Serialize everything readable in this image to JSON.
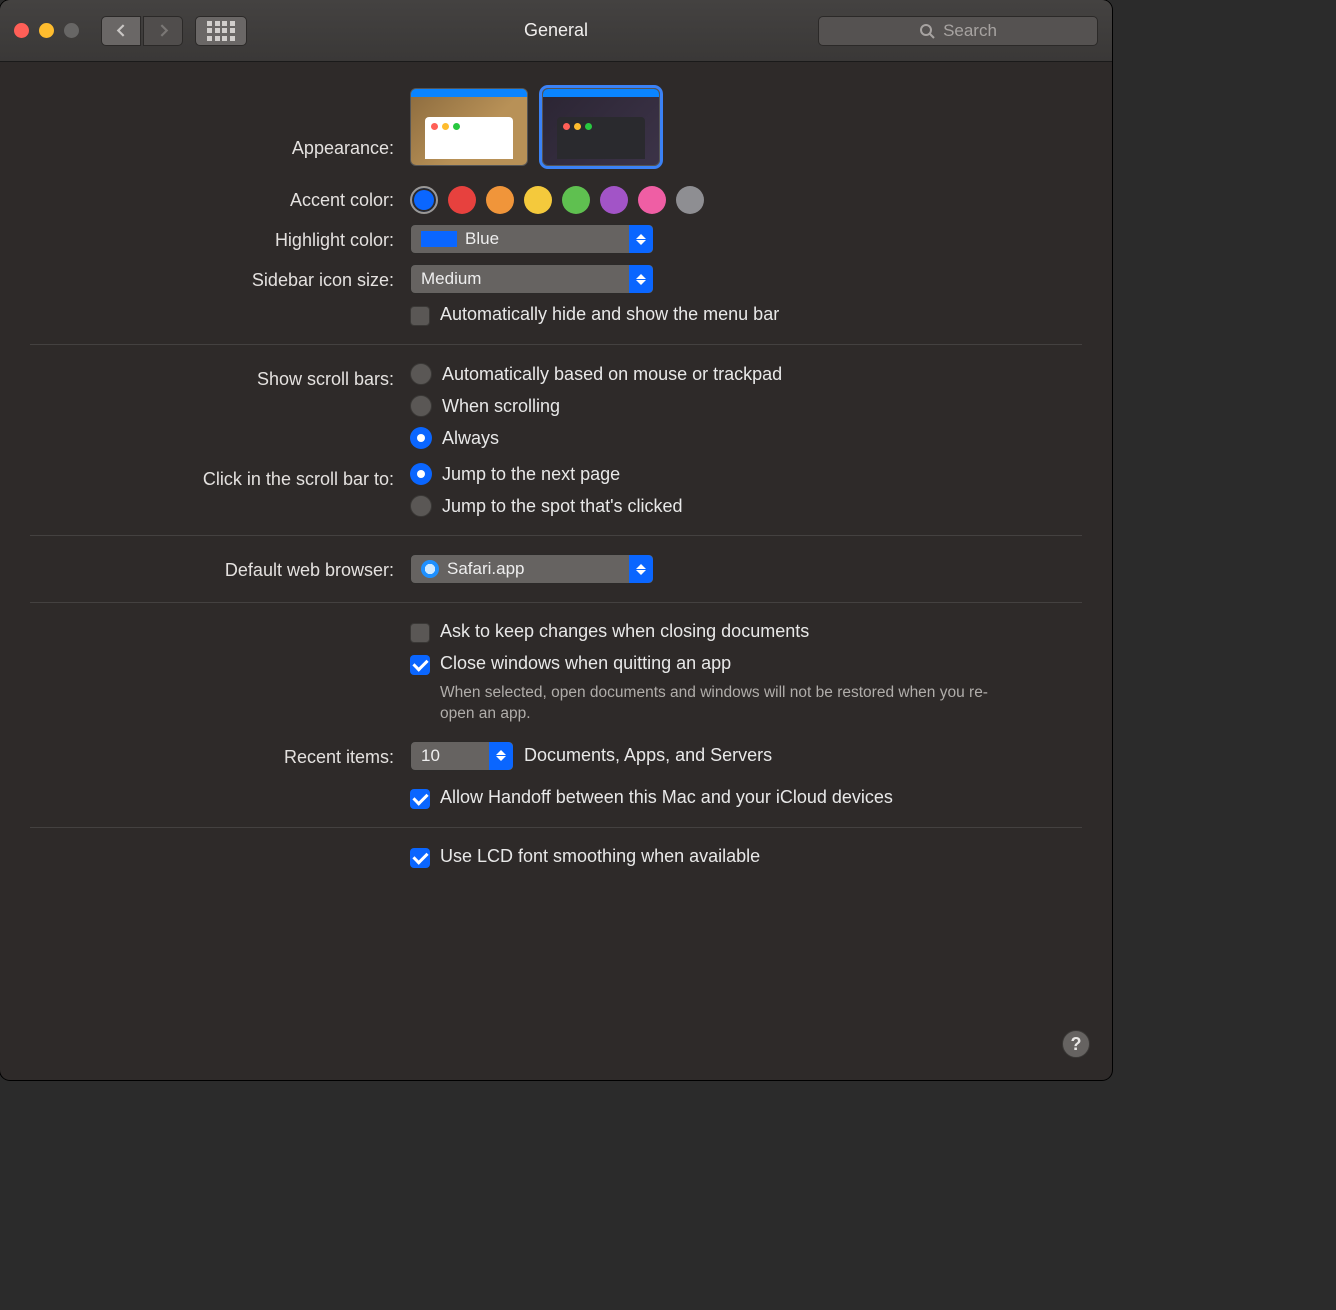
{
  "window": {
    "title": "General"
  },
  "toolbar": {
    "search_placeholder": "Search"
  },
  "labels": {
    "appearance": "Appearance:",
    "accent_color": "Accent color:",
    "highlight_color": "Highlight color:",
    "sidebar_icon_size": "Sidebar icon size:",
    "show_scroll_bars": "Show scroll bars:",
    "click_scroll_bar": "Click in the scroll bar to:",
    "default_browser": "Default web browser:",
    "recent_items": "Recent items:"
  },
  "appearance": {
    "selected": "dark"
  },
  "accent_colors": {
    "options": [
      {
        "name": "Blue",
        "hex": "#0a66ff"
      },
      {
        "name": "Red",
        "hex": "#e7413e"
      },
      {
        "name": "Orange",
        "hex": "#f0953a"
      },
      {
        "name": "Yellow",
        "hex": "#f4c93c"
      },
      {
        "name": "Green",
        "hex": "#5fc050"
      },
      {
        "name": "Purple",
        "hex": "#a254c7"
      },
      {
        "name": "Pink",
        "hex": "#ef5ea4"
      },
      {
        "name": "Graphite",
        "hex": "#8e8e92"
      }
    ],
    "selected_index": 0
  },
  "highlight_color": {
    "value": "Blue"
  },
  "sidebar_icon_size": {
    "value": "Medium"
  },
  "auto_hide_menubar": {
    "label": "Automatically hide and show the menu bar",
    "checked": false
  },
  "scroll_bars": {
    "options": [
      "Automatically based on mouse or trackpad",
      "When scrolling",
      "Always"
    ],
    "selected_index": 2
  },
  "click_scroll": {
    "options": [
      "Jump to the next page",
      "Jump to the spot that's clicked"
    ],
    "selected_index": 0
  },
  "default_browser": {
    "value": "Safari.app"
  },
  "ask_keep_changes": {
    "label": "Ask to keep changes when closing documents",
    "checked": false
  },
  "close_windows": {
    "label": "Close windows when quitting an app",
    "checked": true,
    "description": "When selected, open documents and windows will not be restored when you re-open an app."
  },
  "recent_items": {
    "value": "10",
    "suffix": "Documents, Apps, and Servers"
  },
  "handoff": {
    "label": "Allow Handoff between this Mac and your iCloud devices",
    "checked": true
  },
  "lcd_smoothing": {
    "label": "Use LCD font smoothing when available",
    "checked": true
  },
  "help": "?"
}
